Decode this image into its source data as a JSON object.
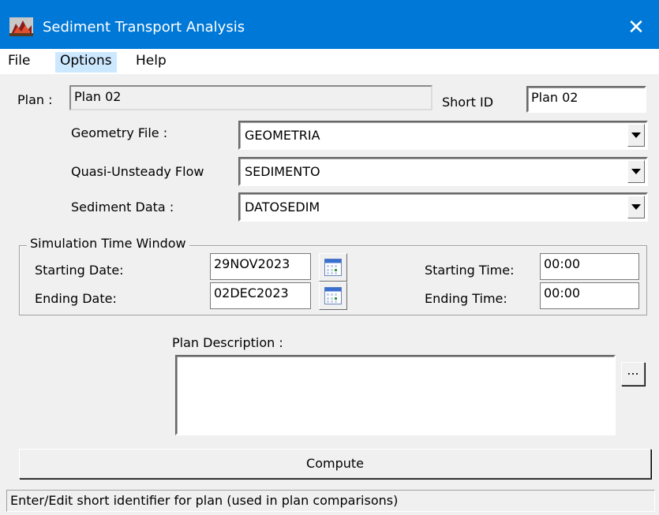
{
  "window": {
    "title": "Sediment Transport Analysis",
    "close_glyph": "✕",
    "title_bar_color": "#0078d7"
  },
  "menu": {
    "items": [
      {
        "label": "File"
      },
      {
        "label": "Options"
      },
      {
        "label": "Help"
      }
    ]
  },
  "plan": {
    "label": "Plan :",
    "value": "Plan 02",
    "short_id_label": "Short ID",
    "short_id_value": "Plan 02"
  },
  "geometry": {
    "label": "Geometry File :",
    "value": "GEOMETRIA"
  },
  "flow": {
    "label": "Quasi-Unsteady Flow",
    "value": "SEDIMENTO"
  },
  "sediment": {
    "label": "Sediment Data :",
    "value": "DATOSEDIM"
  },
  "simulation": {
    "group_title": "Simulation Time Window",
    "starting_date_label": "Starting Date:",
    "starting_date": "29NOV2023",
    "ending_date_label": "Ending Date:",
    "ending_date": "02DEC2023",
    "starting_time_label": "Starting Time:",
    "starting_time": "00:00",
    "ending_time_label": "Ending Time:",
    "ending_time": "00:00"
  },
  "description": {
    "label": "Plan Description :",
    "value": "",
    "browse_label": "..."
  },
  "compute": {
    "label": "Compute"
  },
  "status": {
    "text": "Enter/Edit short identifier for plan (used in plan comparisons)"
  },
  "icons": {
    "app": "app-icon",
    "calendar": "calendar-icon",
    "dropdown": "chevron-down-icon",
    "close": "close-icon"
  }
}
